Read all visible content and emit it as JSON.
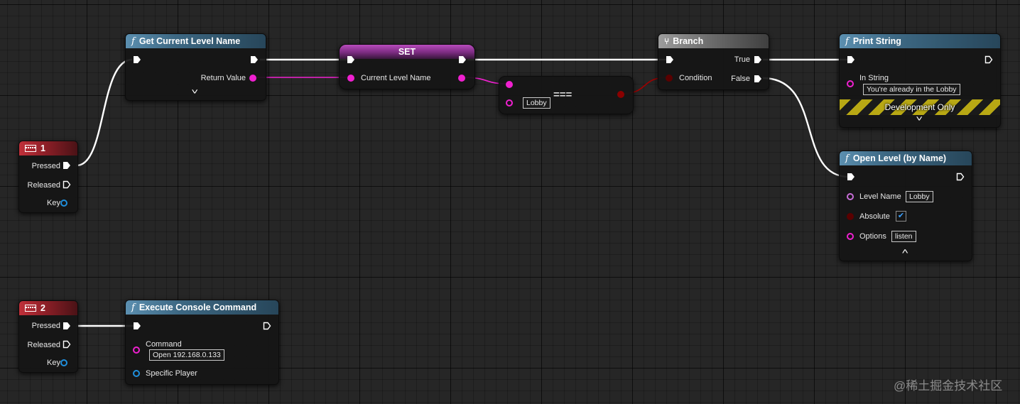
{
  "nodes": {
    "get_level_name": {
      "title": "Get Current Level Name",
      "output_label": "Return Value"
    },
    "set_var": {
      "title": "SET",
      "input_label": "Current Level Name"
    },
    "equal": {
      "operator": "===",
      "literal": "Lobby"
    },
    "branch": {
      "title": "Branch",
      "condition_label": "Condition",
      "true_label": "True",
      "false_label": "False"
    },
    "print_string": {
      "title": "Print String",
      "in_string_label": "In String",
      "in_string_value": "You're already in the Lobby",
      "dev_only_label": "Development Only"
    },
    "open_level": {
      "title": "Open Level (by Name)",
      "level_name_label": "Level Name",
      "level_name_value": "Lobby",
      "absolute_label": "Absolute",
      "absolute_checked": true,
      "options_label": "Options",
      "options_value": "listen"
    },
    "key1": {
      "title": "1",
      "pressed_label": "Pressed",
      "released_label": "Released",
      "key_label": "Key"
    },
    "key2": {
      "title": "2",
      "pressed_label": "Pressed",
      "released_label": "Released",
      "key_label": "Key"
    },
    "exec_console": {
      "title": "Execute Console Command",
      "command_label": "Command",
      "command_value": "Open 192.168.0.133",
      "player_label": "Specific Player"
    }
  },
  "icons": {
    "function": "function-icon",
    "keyboard": "keyboard-icon",
    "branch": "branch-icon",
    "expand": "chevron-down-icon",
    "collapse": "chevron-up-icon",
    "checkmark": "checkmark-icon"
  },
  "colors": {
    "exec_wire": "#ffffff",
    "string_pin": "#f020d0",
    "bool_pin": "#8a0000",
    "object_pin": "#1f8fdc",
    "name_pin": "#c86ed8",
    "function_header": "#3d6883",
    "event_header": "#8d1f27",
    "set_header": "#7a2b80",
    "branch_header": "#6e6e6e"
  },
  "watermark": "@稀土掘金技术社区"
}
